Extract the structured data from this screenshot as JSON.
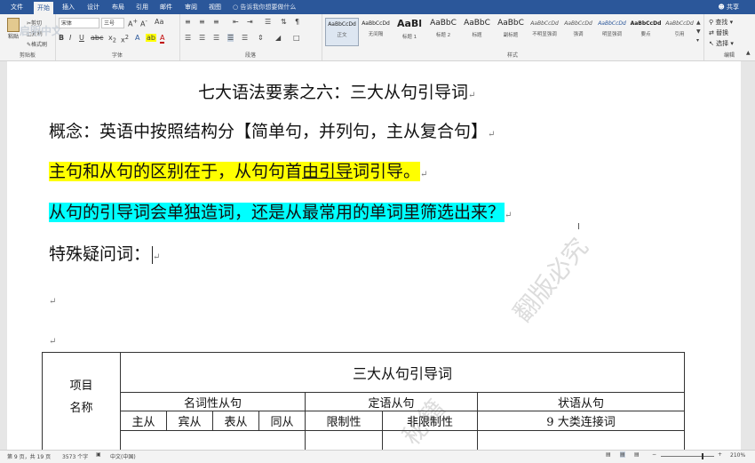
{
  "ribbon_tabs": [
    "文件",
    "开始",
    "插入",
    "设计",
    "布局",
    "引用",
    "邮件",
    "审阅",
    "视图"
  ],
  "tell_me": "告诉我你想要做什么",
  "share": "共享",
  "clipboard": {
    "paste": "粘贴",
    "cut": "剪切",
    "copy": "复制",
    "format_painter": "格式刷",
    "label": "剪贴板"
  },
  "font": {
    "name": "宋体",
    "size": "三号",
    "label": "字体"
  },
  "paragraph_label": "段落",
  "styles": {
    "label": "样式",
    "items": [
      {
        "preview": "AaBbCcDd",
        "name": "正文"
      },
      {
        "preview": "AaBbCcDd",
        "name": "无间隔"
      },
      {
        "preview": "AaBl",
        "name": "标题 1"
      },
      {
        "preview": "AaBbC",
        "name": "标题 2"
      },
      {
        "preview": "AaBbC",
        "name": "标题"
      },
      {
        "preview": "AaBbC",
        "name": "副标题"
      },
      {
        "preview": "AaBbCcDd",
        "name": "不明显强调"
      },
      {
        "preview": "AaBbCcDd",
        "name": "强调"
      },
      {
        "preview": "AaBbCcDd",
        "name": "明显强调"
      },
      {
        "preview": "AaBbCcDd",
        "name": "要点"
      },
      {
        "preview": "AaBbCcDd",
        "name": "引用"
      }
    ]
  },
  "editing": {
    "find": "查找",
    "replace": "替换",
    "select": "选择",
    "label": "编辑"
  },
  "document": {
    "title": "七大语法要素之六：三大从句引导词",
    "line1": "概念：英语中按照结构分【简单句，并列句，主从复合句】",
    "line2_a": "主句和从句的区别在于，从句句首",
    "line2_b": "由引导",
    "line2_c": "词引导。",
    "line3": "从句的引导词会单独造词，还是从最常用的单词里筛选出来？",
    "line4": "特殊疑问词："
  },
  "table": {
    "header_item": "项目",
    "header_name": "名称",
    "title": "三大从句引导词",
    "groups": [
      "名词性从句",
      "定语从句",
      "状语从句"
    ],
    "subheaders": [
      "主从",
      "宾从",
      "表从",
      "同从",
      "限制性",
      "非限制性",
      "9 大类连接词"
    ]
  },
  "watermark": {
    "top": "翻版必究",
    "bottom": "秘籍"
  },
  "logo_text": "启明中文",
  "status": {
    "page": "第 9 页，共 19 页",
    "words": "3573 个字",
    "lang": "中文(中国)",
    "zoom": "210%"
  },
  "colors": {
    "accent": "#2b579a",
    "highlight_yellow": "#ffff00",
    "highlight_cyan": "#00ffff"
  }
}
